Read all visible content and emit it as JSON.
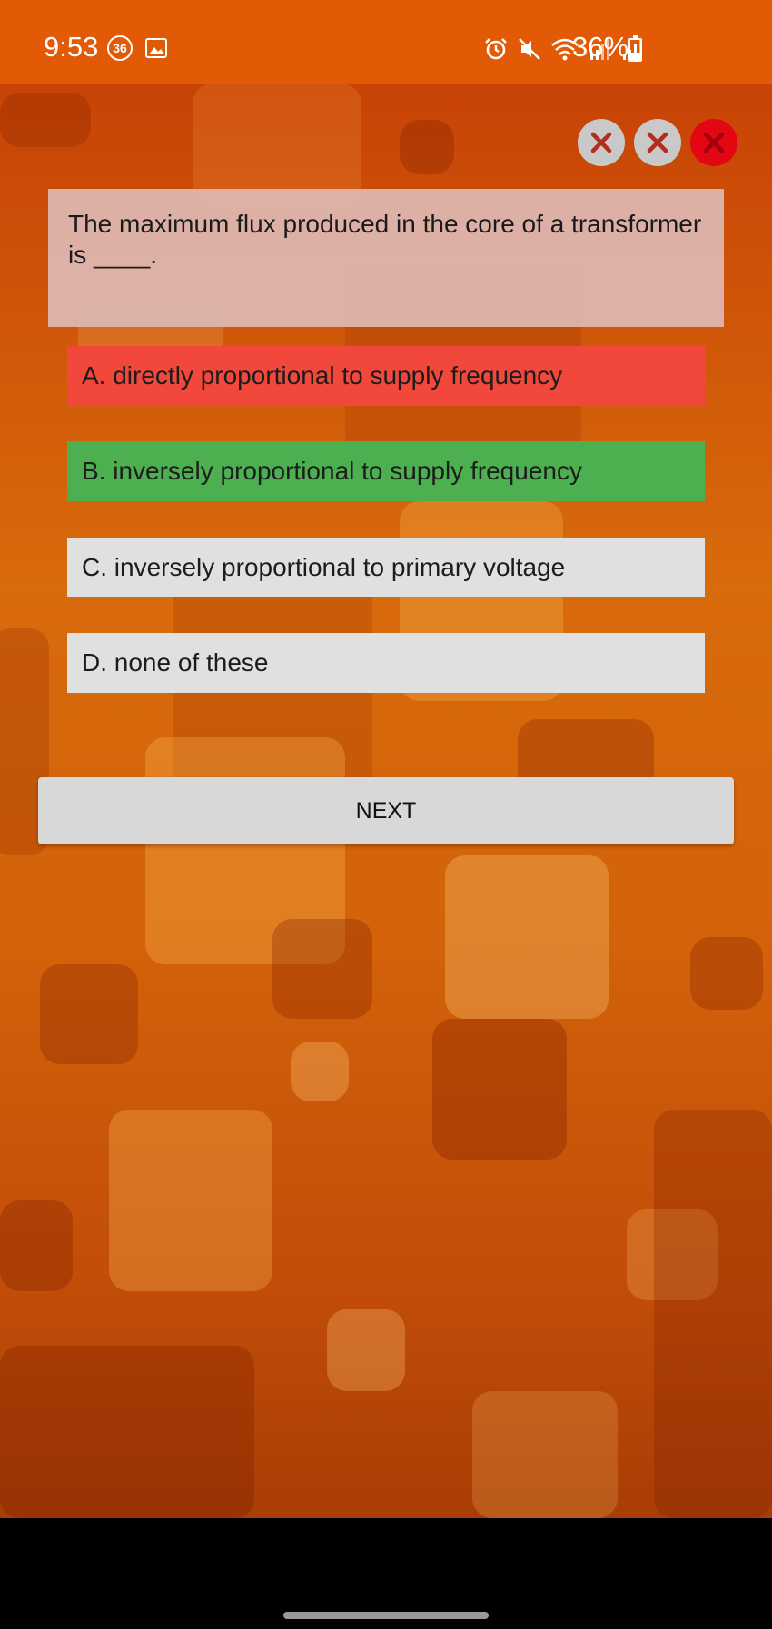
{
  "status_bar": {
    "time": "9:53",
    "notification_badge": "36",
    "battery_text": "36%",
    "battery_level_percent": 36,
    "icons": [
      "gallery-icon",
      "alarm-icon",
      "mute-icon",
      "wifi-icon",
      "signal-icon",
      "signal-icon",
      "battery-icon"
    ]
  },
  "lives": [
    {
      "state": "used",
      "icon": "close-icon"
    },
    {
      "state": "used",
      "icon": "close-icon"
    },
    {
      "state": "active",
      "icon": "close-icon"
    }
  ],
  "question": {
    "text": "The maximum flux produced in the core of a transformer is ____."
  },
  "options": [
    {
      "label": "A. directly proportional to supply frequency",
      "state": "wrong",
      "color": "#f2473b"
    },
    {
      "label": "B. inversely proportional to supply frequency",
      "state": "correct",
      "color": "#4caf50"
    },
    {
      "label": "C. inversely proportional to primary voltage",
      "state": "neutral",
      "color": "#e0e0e0"
    },
    {
      "label": "D. none of these",
      "state": "neutral",
      "color": "#e0e0e0"
    }
  ],
  "next_button": {
    "label": "NEXT"
  },
  "colors": {
    "status_bar": "#e25a06",
    "accent": "#e30613"
  }
}
